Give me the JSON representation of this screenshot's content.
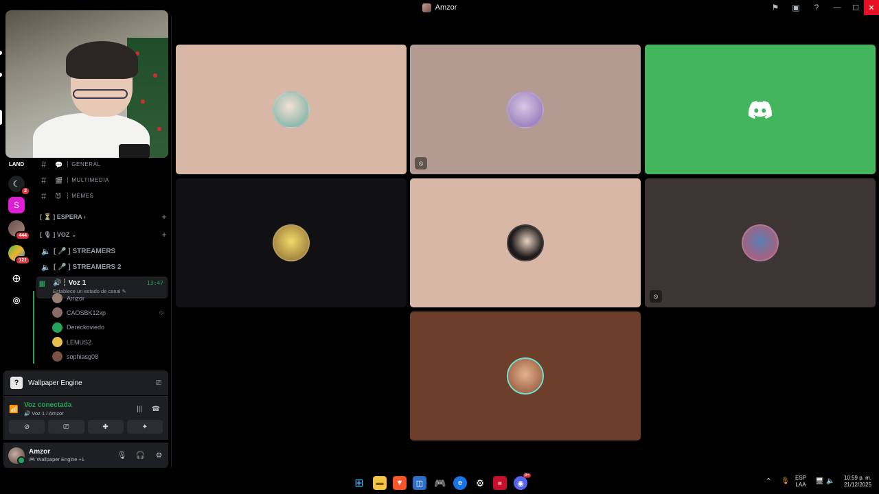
{
  "window": {
    "title": "Amzor",
    "min_label": "—",
    "max_label": "☐",
    "close_label": "✕"
  },
  "rail": {
    "badges": [
      "2",
      "444",
      "121"
    ],
    "letter_s": "S"
  },
  "channels": {
    "text": [
      {
        "name": "┆ general",
        "emoji": "💬"
      },
      {
        "name": "┆ multimedia",
        "emoji": "🎬"
      },
      {
        "name": "┆ memes",
        "emoji": "😈"
      }
    ],
    "cat_espera": "[ ⏳ ] ESPERA ›",
    "cat_voz": "[ 🎙 ] VOZ ⌄",
    "voice": [
      {
        "name": "[ 🎤 ] STREAMERS"
      },
      {
        "name": "[ 🎤 ] STREAMERS 2"
      }
    ],
    "active": {
      "name": "┆ Voz 1",
      "time": "13:47",
      "status": "Establece un estado de canal ✎"
    },
    "members": [
      {
        "name": "Amzor",
        "color": "#9a7d72",
        "muted": false
      },
      {
        "name": "CAOSBK12xp",
        "color": "#8b6a6a",
        "muted": true
      },
      {
        "name": "Dereckoviedo",
        "color": "#23a55a",
        "muted": false
      },
      {
        "name": "LEMUS2",
        "color": "#e6c04a",
        "muted": false
      },
      {
        "name": "sophiasg08",
        "color": "#7a5045",
        "muted": false
      }
    ]
  },
  "activity": {
    "name": "Wallpaper Engine"
  },
  "voice": {
    "status": "Voz conectada",
    "channel": "🔊 Voz 1 / Amzor"
  },
  "user": {
    "name": "Amzor",
    "status": "🎮 Wallpaper Engine +1"
  },
  "tiles": [
    {
      "bg": "#d8b7a6",
      "avatar": "#6aa9a0",
      "muted": false
    },
    {
      "bg": "#b39b91",
      "avatar": "#8a6ab0",
      "muted": true
    },
    {
      "bg": "#43b55c",
      "avatar": "discord",
      "muted": false
    },
    {
      "bg": "#111113",
      "avatar": "#e0c35a",
      "muted": false
    },
    {
      "bg": "#d8b7a6",
      "avatar": "#1f1a1a",
      "muted": false
    },
    {
      "bg": "#3d3534",
      "avatar": "#c2556e",
      "muted": true
    },
    {
      "bg": "#6d3f2a",
      "avatar": "#b88a6b",
      "muted": false
    }
  ],
  "taskbar": {
    "lang1": "ESP",
    "lang2": "LAA",
    "time": "10:59 p. m.",
    "date": "21/12/2025",
    "notify_count": "9+"
  }
}
